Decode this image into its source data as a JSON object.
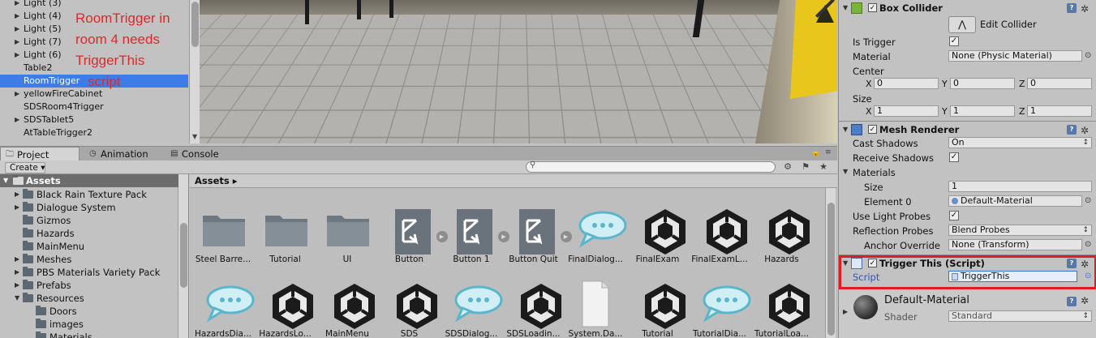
{
  "hierarchy": {
    "items": [
      {
        "label": "Light (3)",
        "expandable": true
      },
      {
        "label": "Light (4)",
        "expandable": true
      },
      {
        "label": "Light (5)",
        "expandable": true
      },
      {
        "label": "Light (7)",
        "expandable": true
      },
      {
        "label": "Light (6)",
        "expandable": true
      },
      {
        "label": "Table2",
        "expandable": false
      },
      {
        "label": "RoomTrigger",
        "expandable": false,
        "selected": true
      },
      {
        "label": "yellowFireCabinet",
        "expandable": true
      },
      {
        "label": "SDSRoom4Trigger",
        "expandable": false
      },
      {
        "label": "SDSTablet5",
        "expandable": true
      },
      {
        "label": "AtTableTrigger2",
        "expandable": false
      }
    ],
    "annotation": [
      "RoomTrigger in",
      "room 4 needs",
      "TriggerThis",
      "script"
    ]
  },
  "tabs": [
    {
      "label": "Project",
      "icon": "folder-icon",
      "active": true
    },
    {
      "label": "Animation",
      "icon": "clock-icon",
      "active": false
    },
    {
      "label": "Console",
      "icon": "console-icon",
      "active": false
    }
  ],
  "toolbar": {
    "create_label": "Create ▾",
    "search_placeholder": ""
  },
  "tree": {
    "root": "Assets",
    "items": [
      {
        "label": "Black Rain Texture Pack",
        "expandable": true
      },
      {
        "label": "Dialogue System",
        "expandable": true
      },
      {
        "label": "Gizmos",
        "expandable": false
      },
      {
        "label": "Hazards",
        "expandable": false
      },
      {
        "label": "MainMenu",
        "expandable": false
      },
      {
        "label": "Meshes",
        "expandable": true
      },
      {
        "label": "PBS Materials Variety Pack",
        "expandable": true
      },
      {
        "label": "Prefabs",
        "expandable": true
      },
      {
        "label": "Resources",
        "expandable": true,
        "expanded": true
      },
      {
        "label": "Doors",
        "expandable": false,
        "child": true
      },
      {
        "label": "images",
        "expandable": false,
        "child": true
      },
      {
        "label": "Materials",
        "expandable": false,
        "child": true
      }
    ]
  },
  "assets": {
    "breadcrumb": "Assets ▸",
    "row1": [
      {
        "label": "Steel Barre...",
        "type": "folder"
      },
      {
        "label": "Tutorial",
        "type": "folder"
      },
      {
        "label": "UI",
        "type": "folder"
      },
      {
        "label": "Button",
        "type": "prefab"
      },
      {
        "label": "Button 1",
        "type": "prefab"
      },
      {
        "label": "Button Quit",
        "type": "prefab"
      },
      {
        "label": "FinalDialog...",
        "type": "dialog"
      },
      {
        "label": "FinalExam",
        "type": "unity"
      },
      {
        "label": "FinalExamL...",
        "type": "unity"
      },
      {
        "label": "Hazards",
        "type": "unity"
      }
    ],
    "row2": [
      {
        "label": "HazardsDia...",
        "type": "dialog"
      },
      {
        "label": "HazardsLo...",
        "type": "unity"
      },
      {
        "label": "MainMenu",
        "type": "unity"
      },
      {
        "label": "SDS",
        "type": "unity"
      },
      {
        "label": "SDSDialog...",
        "type": "dialog"
      },
      {
        "label": "SDSLoadin...",
        "type": "unity"
      },
      {
        "label": "System.Da...",
        "type": "file"
      },
      {
        "label": "Tutorial",
        "type": "unity"
      },
      {
        "label": "TutorialDia...",
        "type": "dialog"
      },
      {
        "label": "TutorialLoa...",
        "type": "unity"
      }
    ]
  },
  "inspector": {
    "box_collider": {
      "title": "Box Collider",
      "edit_collider_label": "Edit Collider",
      "is_trigger_label": "Is Trigger",
      "is_trigger": true,
      "material_label": "Material",
      "material_value": "None (Physic Material)",
      "center_label": "Center",
      "center": {
        "x": "0",
        "y": "0",
        "z": "0"
      },
      "size_label": "Size",
      "size": {
        "x": "1",
        "y": "1",
        "z": "1"
      }
    },
    "mesh_renderer": {
      "title": "Mesh Renderer",
      "cast_shadows_label": "Cast Shadows",
      "cast_shadows_value": "On",
      "receive_shadows_label": "Receive Shadows",
      "receive_shadows": true,
      "materials_label": "Materials",
      "size_label": "Size",
      "size_value": "1",
      "element0_label": "Element 0",
      "element0_value": "Default-Material",
      "use_light_probes_label": "Use Light Probes",
      "use_light_probes": true,
      "reflection_probes_label": "Reflection Probes",
      "reflection_probes_value": "Blend Probes",
      "anchor_override_label": "Anchor Override",
      "anchor_override_value": "None (Transform)"
    },
    "trigger_this": {
      "title": "Trigger This (Script)",
      "script_label": "Script",
      "script_value": "TriggerThis"
    },
    "material": {
      "title": "Default-Material",
      "shader_label": "Shader",
      "shader_value": "Standard"
    },
    "axis_labels": {
      "x": "X",
      "y": "Y",
      "z": "Z"
    },
    "help_glyph": "?",
    "gear_glyph": "✲",
    "check_glyph": "✓"
  },
  "colors": {
    "selection": "#3e7de7",
    "annotation": "#e0282c",
    "highlight_box": "#e01b24",
    "script_link": "#2f55b5"
  }
}
